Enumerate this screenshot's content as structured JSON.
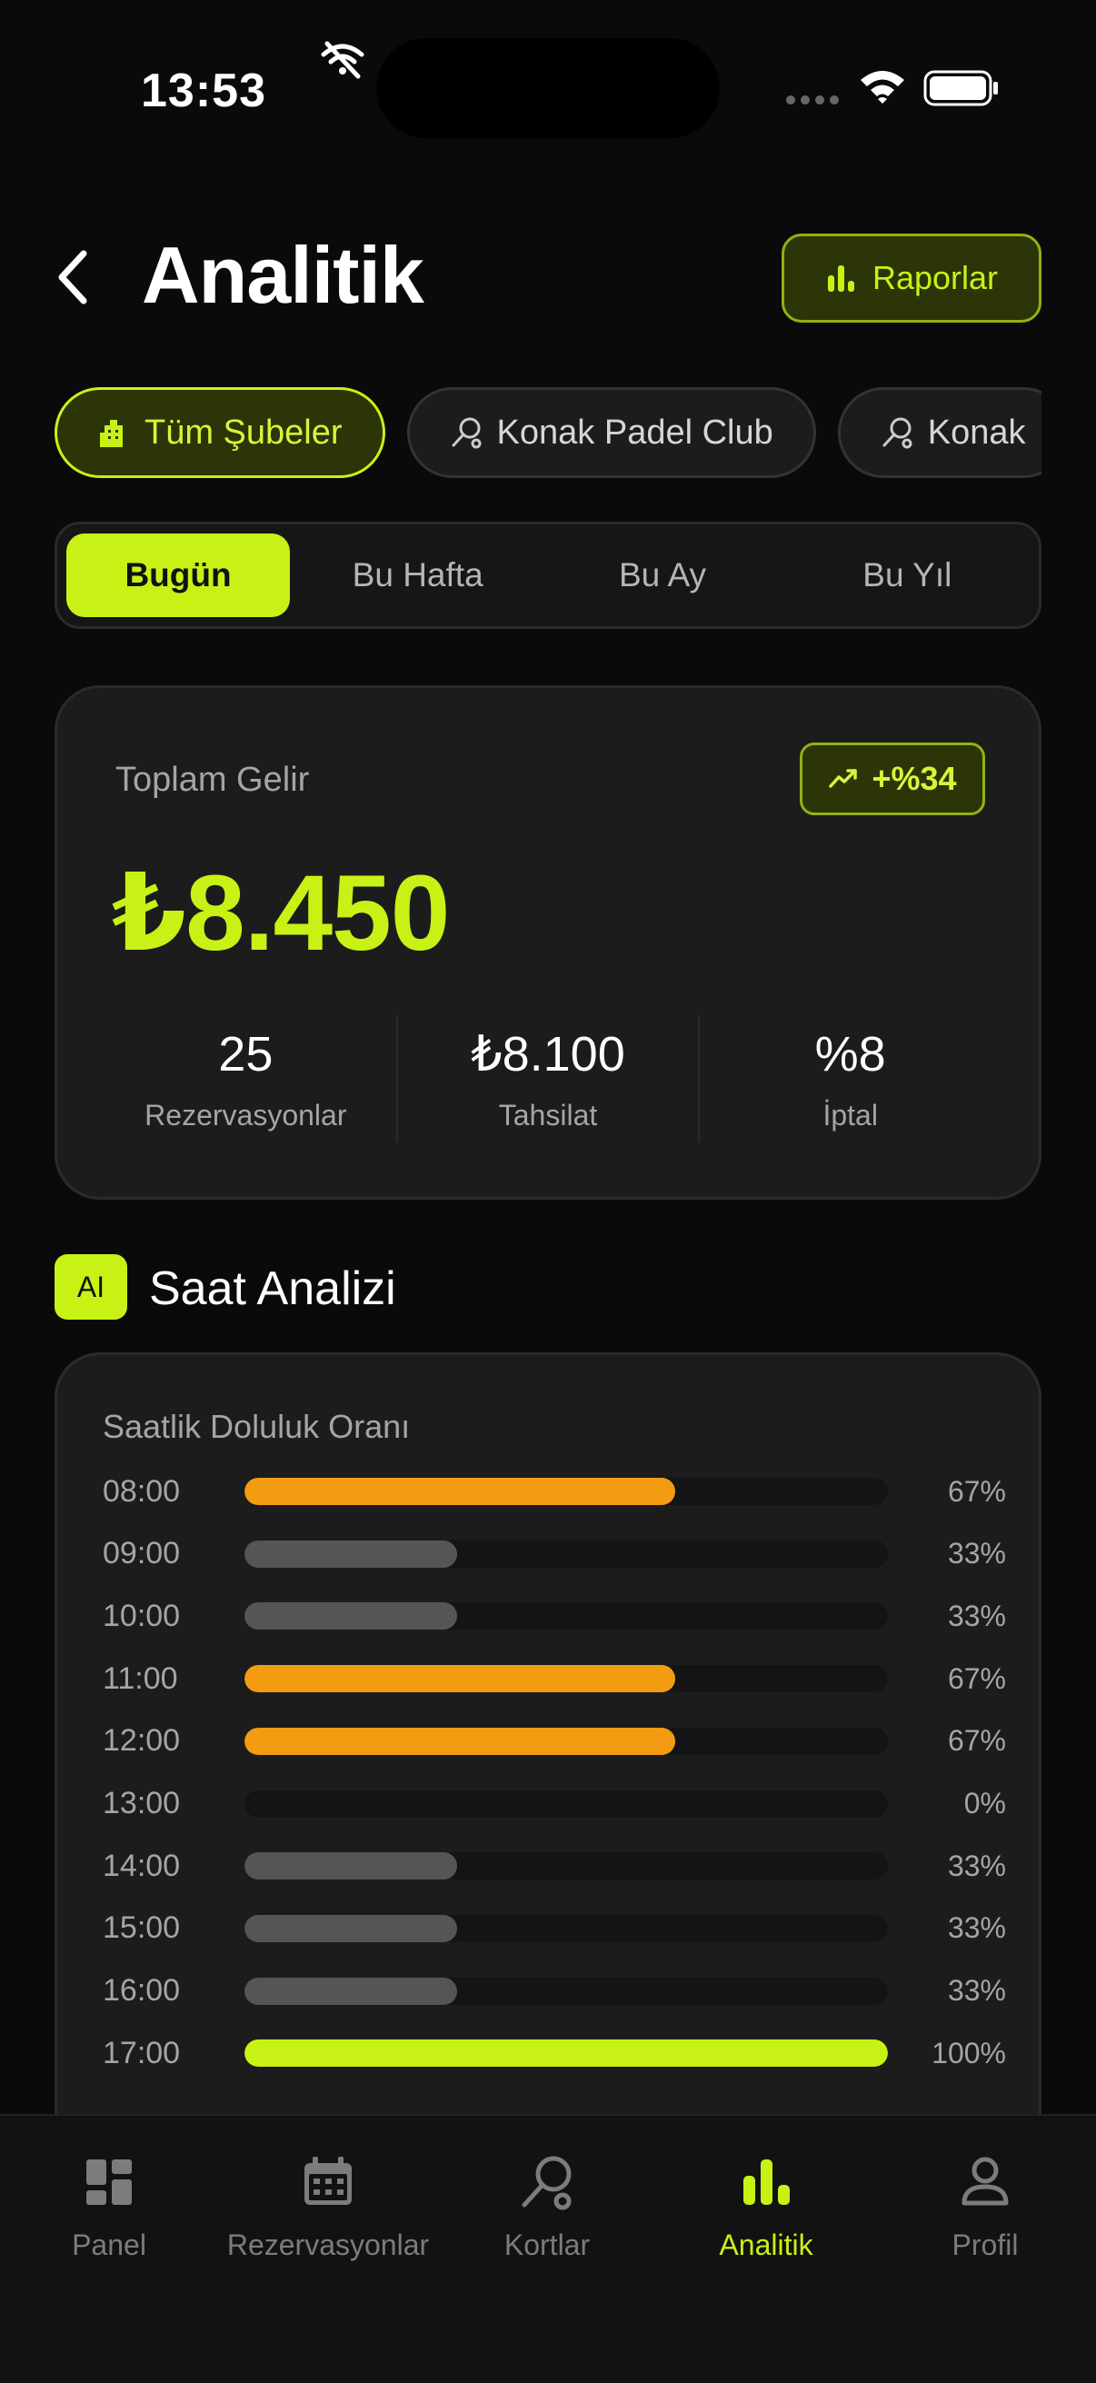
{
  "status": {
    "time": "13:53"
  },
  "header": {
    "title": "Analitik",
    "reports_label": "Raporlar"
  },
  "branches": [
    {
      "label": "Tüm Şubeler",
      "icon": "building-icon",
      "active": true
    },
    {
      "label": "Konak Padel Club",
      "icon": "racket-icon",
      "active": false
    },
    {
      "label": "Konak",
      "icon": "racket-icon",
      "active": false
    }
  ],
  "periods": [
    {
      "label": "Bugün",
      "active": true
    },
    {
      "label": "Bu Hafta",
      "active": false
    },
    {
      "label": "Bu Ay",
      "active": false
    },
    {
      "label": "Bu Yıl",
      "active": false
    }
  ],
  "revenue": {
    "label": "Toplam Gelir",
    "trend": "+%34",
    "value": "₺8.450",
    "stats": [
      {
        "value": "25",
        "label": "Rezervasyonlar"
      },
      {
        "value": "₺8.100",
        "label": "Tahsilat"
      },
      {
        "value": "%8",
        "label": "İptal"
      }
    ]
  },
  "hour_analysis": {
    "badge": "AI",
    "title": "Saat Analizi",
    "card_title": "Saatlik Doluluk Oranı",
    "rows": [
      {
        "hour": "08:00",
        "pct_label": "67%",
        "value": 67,
        "color": "#f39c12"
      },
      {
        "hour": "09:00",
        "pct_label": "33%",
        "value": 33,
        "color": "#555555"
      },
      {
        "hour": "10:00",
        "pct_label": "33%",
        "value": 33,
        "color": "#555555"
      },
      {
        "hour": "11:00",
        "pct_label": "67%",
        "value": 67,
        "color": "#f39c12"
      },
      {
        "hour": "12:00",
        "pct_label": "67%",
        "value": 67,
        "color": "#f39c12"
      },
      {
        "hour": "13:00",
        "pct_label": "0%",
        "value": 0,
        "color": "#555555"
      },
      {
        "hour": "14:00",
        "pct_label": "33%",
        "value": 33,
        "color": "#555555"
      },
      {
        "hour": "15:00",
        "pct_label": "33%",
        "value": 33,
        "color": "#555555"
      },
      {
        "hour": "16:00",
        "pct_label": "33%",
        "value": 33,
        "color": "#555555"
      },
      {
        "hour": "17:00",
        "pct_label": "100%",
        "value": 100,
        "color": "#c8f215"
      }
    ]
  },
  "nav": [
    {
      "label": "Panel",
      "icon": "dashboard-icon",
      "active": false
    },
    {
      "label": "Rezervasyonlar",
      "icon": "calendar-icon",
      "active": false
    },
    {
      "label": "Kortlar",
      "icon": "racket-icon",
      "active": false
    },
    {
      "label": "Analitik",
      "icon": "bar-chart-icon",
      "active": true
    },
    {
      "label": "Profil",
      "icon": "user-icon",
      "active": false
    }
  ],
  "colors": {
    "accent": "#c8f215",
    "high": "#f39c12",
    "low": "#555555",
    "background": "#0a0a0a"
  }
}
